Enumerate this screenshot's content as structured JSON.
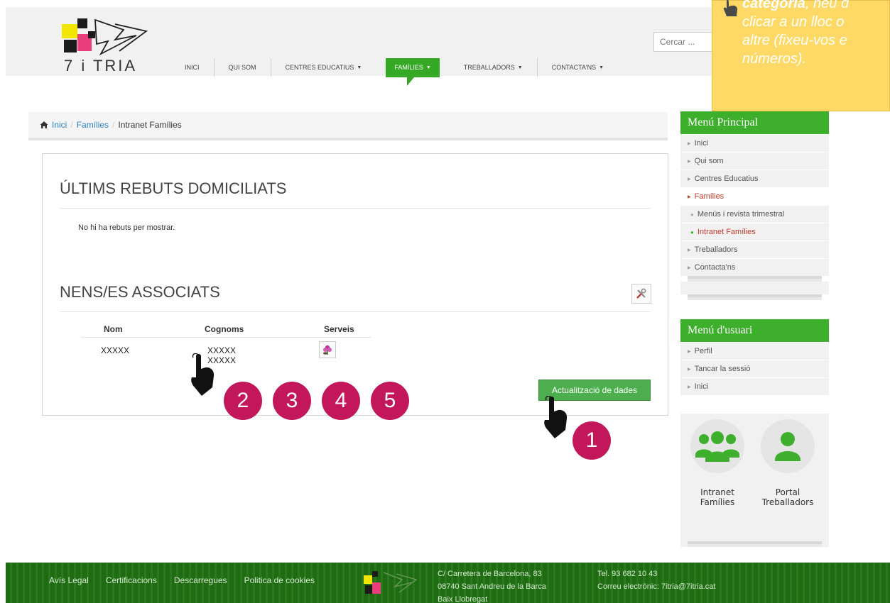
{
  "header": {
    "logo_text": "7 i TRIA",
    "nav": [
      {
        "label": "INICI",
        "caret": false,
        "active": false
      },
      {
        "label": "QUI SOM",
        "caret": false,
        "active": false
      },
      {
        "label": "CENTRES EDUCATIUS",
        "caret": true,
        "active": false
      },
      {
        "label": "FAMÍLIES",
        "caret": true,
        "active": true
      },
      {
        "label": "TREBALLADORS",
        "caret": true,
        "active": false
      },
      {
        "label": "CONTACTA'NS",
        "caret": true,
        "active": false
      }
    ],
    "search_placeholder": "Cercar ..."
  },
  "note": {
    "line1_bold": "categoria",
    "line1_rest": ", heu d",
    "line2": "clicar a un lloc o",
    "line3": "altre (fixeu-vos e",
    "line4": "números)."
  },
  "breadcrumb": {
    "items": [
      "Inici",
      "Famílies",
      "Intranet Famílies"
    ],
    "separator": "/"
  },
  "main": {
    "receipts_title": "ÚLTIMS REBUTS DOMICILIATS",
    "receipts_empty": "No hi ha rebuts per mostrar.",
    "children_title": "NENS/ES ASSOCIATS",
    "table": {
      "headers": [
        "Nom",
        "Cognoms",
        "Serveis"
      ],
      "rows": [
        {
          "nom": "XXXXX",
          "cognoms": "XXXXX XXXXX"
        }
      ]
    },
    "update_button": "Actualització de dades"
  },
  "annotations": [
    "1",
    "2",
    "3",
    "4",
    "5"
  ],
  "sidebar": {
    "main_menu_title": "Menú Principal",
    "main_items": [
      {
        "label": "Inici",
        "type": "item",
        "active": false
      },
      {
        "label": "Qui som",
        "type": "item",
        "active": false
      },
      {
        "label": "Centres Educatius",
        "type": "item",
        "active": false
      },
      {
        "label": "Famílies",
        "type": "item",
        "active": true
      },
      {
        "label": "Menús i revista trimestral",
        "type": "sub",
        "active": false
      },
      {
        "label": "Intranet Famílies",
        "type": "sub",
        "active": true
      },
      {
        "label": "Treballadors",
        "type": "item",
        "active": false
      },
      {
        "label": "Contacta'ns",
        "type": "item",
        "active": false
      }
    ],
    "user_menu_title": "Menú d'usuari",
    "user_items": [
      "Perfil",
      "Tancar la sessió",
      "Inici"
    ],
    "quick_links": [
      {
        "line1": "Intranet",
        "line2": "Famílies"
      },
      {
        "line1": "Portal",
        "line2": "Treballadors"
      }
    ]
  },
  "footer": {
    "links": [
      "Avís Legal",
      "Certificacions",
      "Descarregues",
      "Politica de cookies"
    ],
    "address": [
      "C/ Carretera de Barcelona, 83",
      "08740 Sant Andreu de la Barca",
      "Baix Llobregat"
    ],
    "phone": "Tel. 93 682 10 43",
    "email": "Correu electrònic: 7itria@7itria.cat"
  },
  "colors": {
    "brand_green": "#3daf2c",
    "annotation_magenta": "#c2185b",
    "note_yellow": "#ffd966",
    "footer_green": "#1e6b14"
  }
}
